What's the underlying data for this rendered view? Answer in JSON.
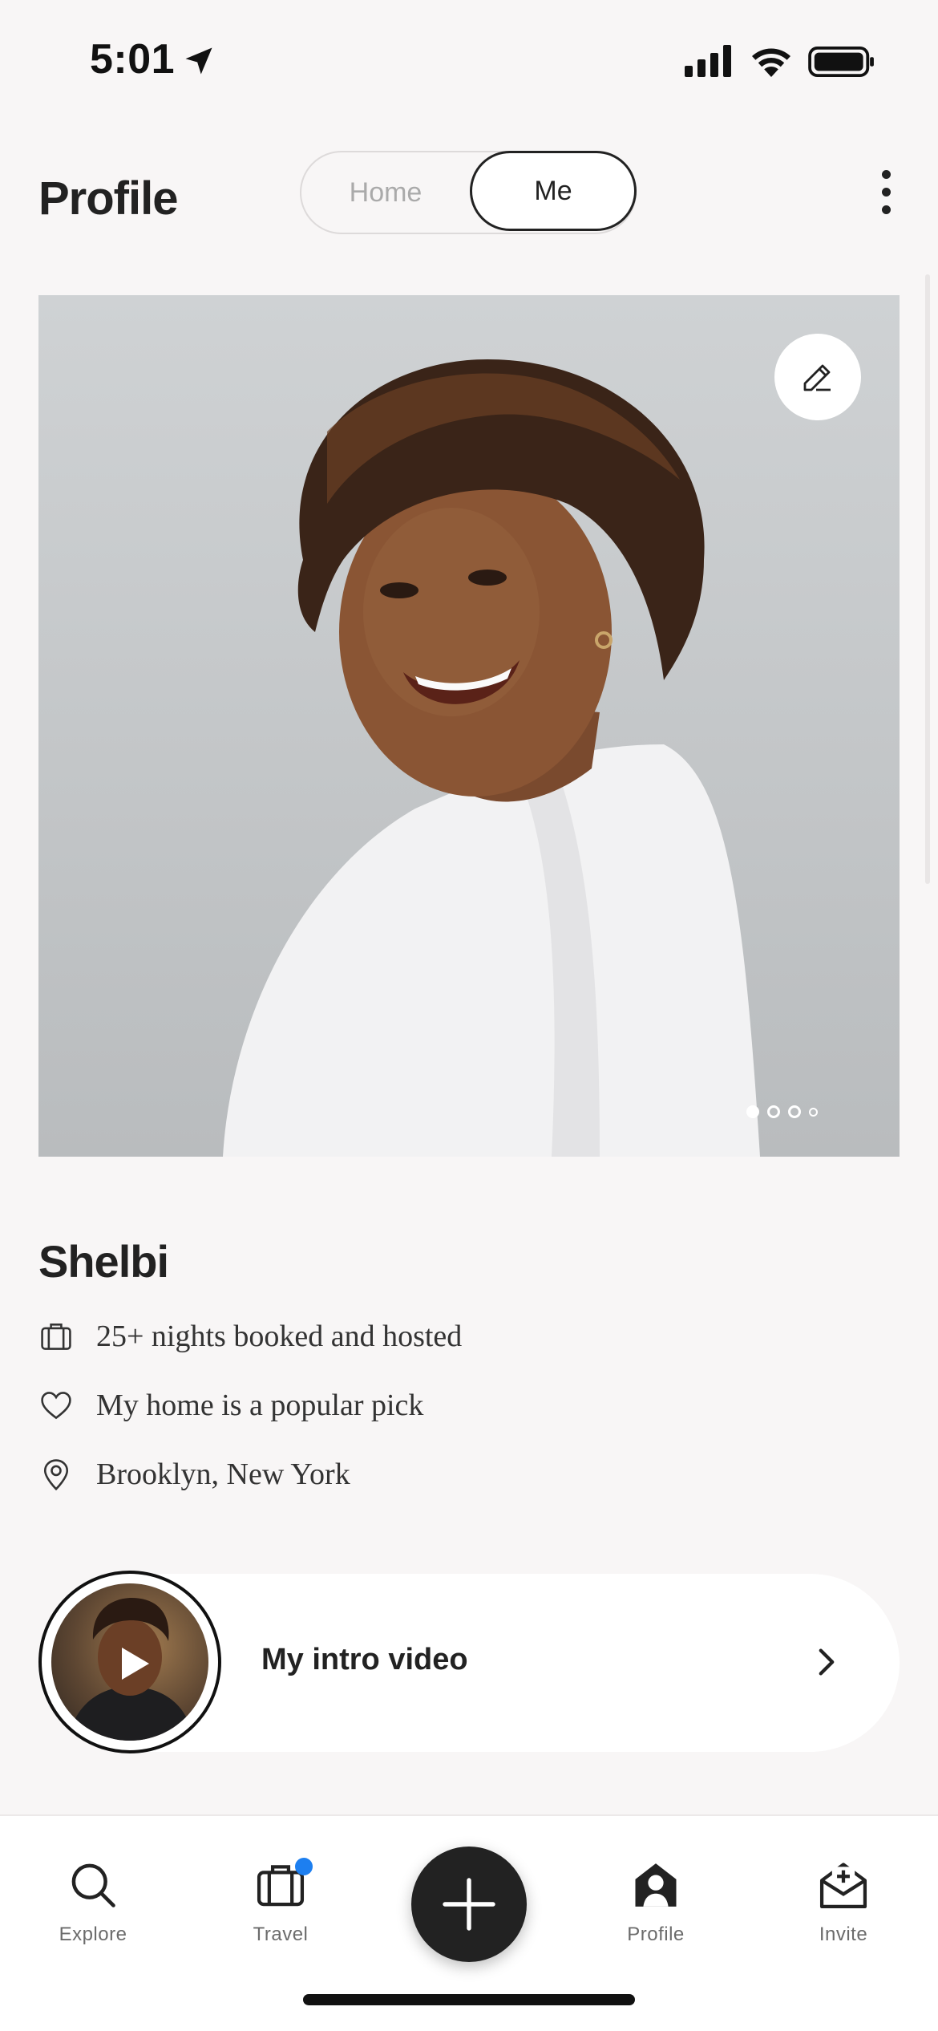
{
  "status_bar": {
    "time": "5:01"
  },
  "header": {
    "title": "Profile",
    "segments": [
      {
        "label": "Home",
        "selected": false
      },
      {
        "label": "Me",
        "selected": true
      }
    ]
  },
  "photo": {
    "pages": 4,
    "current_page": 1
  },
  "profile": {
    "name": "Shelbi",
    "facts": [
      {
        "icon": "suitcase-icon",
        "text": "25+ nights booked and hosted"
      },
      {
        "icon": "heart-icon",
        "text": "My home is a popular pick"
      },
      {
        "icon": "location-pin-icon",
        "text": "Brooklyn, New York"
      }
    ]
  },
  "intro_video": {
    "label": "My intro video"
  },
  "tabbar": {
    "items": [
      {
        "label": "Explore",
        "icon": "search-icon"
      },
      {
        "label": "Travel",
        "icon": "suitcase-icon",
        "badge": true
      },
      {
        "label": "",
        "icon": "plus-icon"
      },
      {
        "label": "Profile",
        "icon": "person-house-icon"
      },
      {
        "label": "Invite",
        "icon": "envelope-plus-icon"
      }
    ]
  },
  "colors": {
    "badge": "#1d7ff0",
    "text": "#222222",
    "background": "#f8f6f6"
  }
}
